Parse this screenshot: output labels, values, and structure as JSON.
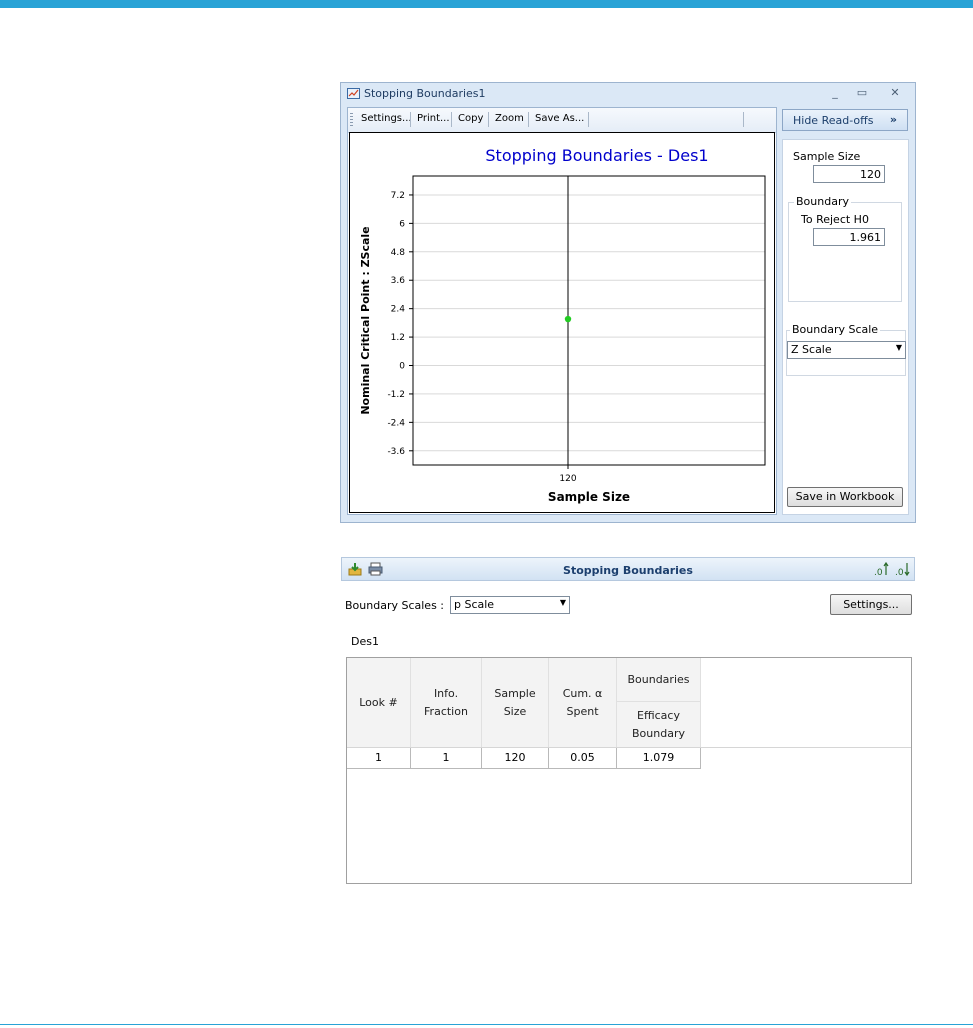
{
  "window": {
    "title": "Stopping Boundaries1",
    "controls": {
      "minimize": "_",
      "maximize": "▭",
      "close": "✕"
    }
  },
  "toolbar": {
    "settings": "Settings...",
    "print": "Print...",
    "copy": "Copy",
    "zoom": "Zoom",
    "save_as": "Save As..."
  },
  "chart_data": {
    "type": "scatter",
    "title": "Stopping Boundaries - Des1",
    "xlabel": "Sample Size",
    "ylabel": "Nominal Critical Point : ZScale",
    "x_ticks": [
      "120"
    ],
    "y_ticks": [
      "7.2",
      "6",
      "4.8",
      "3.6",
      "2.4",
      "1.2",
      "0",
      "-1.2",
      "-2.4",
      "-3.6"
    ],
    "ylim": [
      -4.2,
      8.0
    ],
    "grid": "horizontal",
    "vertical_reference_line": 120,
    "points": [
      {
        "x": 120,
        "y": 1.961,
        "color": "#22cc22"
      }
    ]
  },
  "readoffs": {
    "hide_label": "Hide Read-offs",
    "hide_chevron": "»",
    "sample_size_label": "Sample Size",
    "sample_size_value": "120",
    "boundary_group": "Boundary",
    "reject_label": "To Reject H0",
    "reject_value": "1.961",
    "scale_group": "Boundary Scale",
    "scale_value": "Z Scale",
    "save_label": "Save in Workbook"
  },
  "panel": {
    "title": "Stopping Boundaries",
    "scales_label": "Boundary Scales :",
    "scale_value": "p Scale",
    "settings_label": "Settings...",
    "design_label": "Des1"
  },
  "table": {
    "headers": {
      "look": "Look #",
      "info_1": "Info.",
      "info_2": "Fraction",
      "sample_1": "Sample",
      "sample_2": "Size",
      "cum_1": "Cum. α",
      "cum_2": "Spent",
      "boundaries": "Boundaries",
      "efficacy_1": "Efficacy",
      "efficacy_2": "Boundary"
    },
    "rows": [
      {
        "look": "1",
        "info": "1",
        "sample": "120",
        "cum": "0.05",
        "efficacy": "1.079"
      }
    ]
  },
  "colors": {
    "accent": "#29a3d6",
    "title_blue": "#0000cc",
    "point_green": "#22cc22"
  }
}
